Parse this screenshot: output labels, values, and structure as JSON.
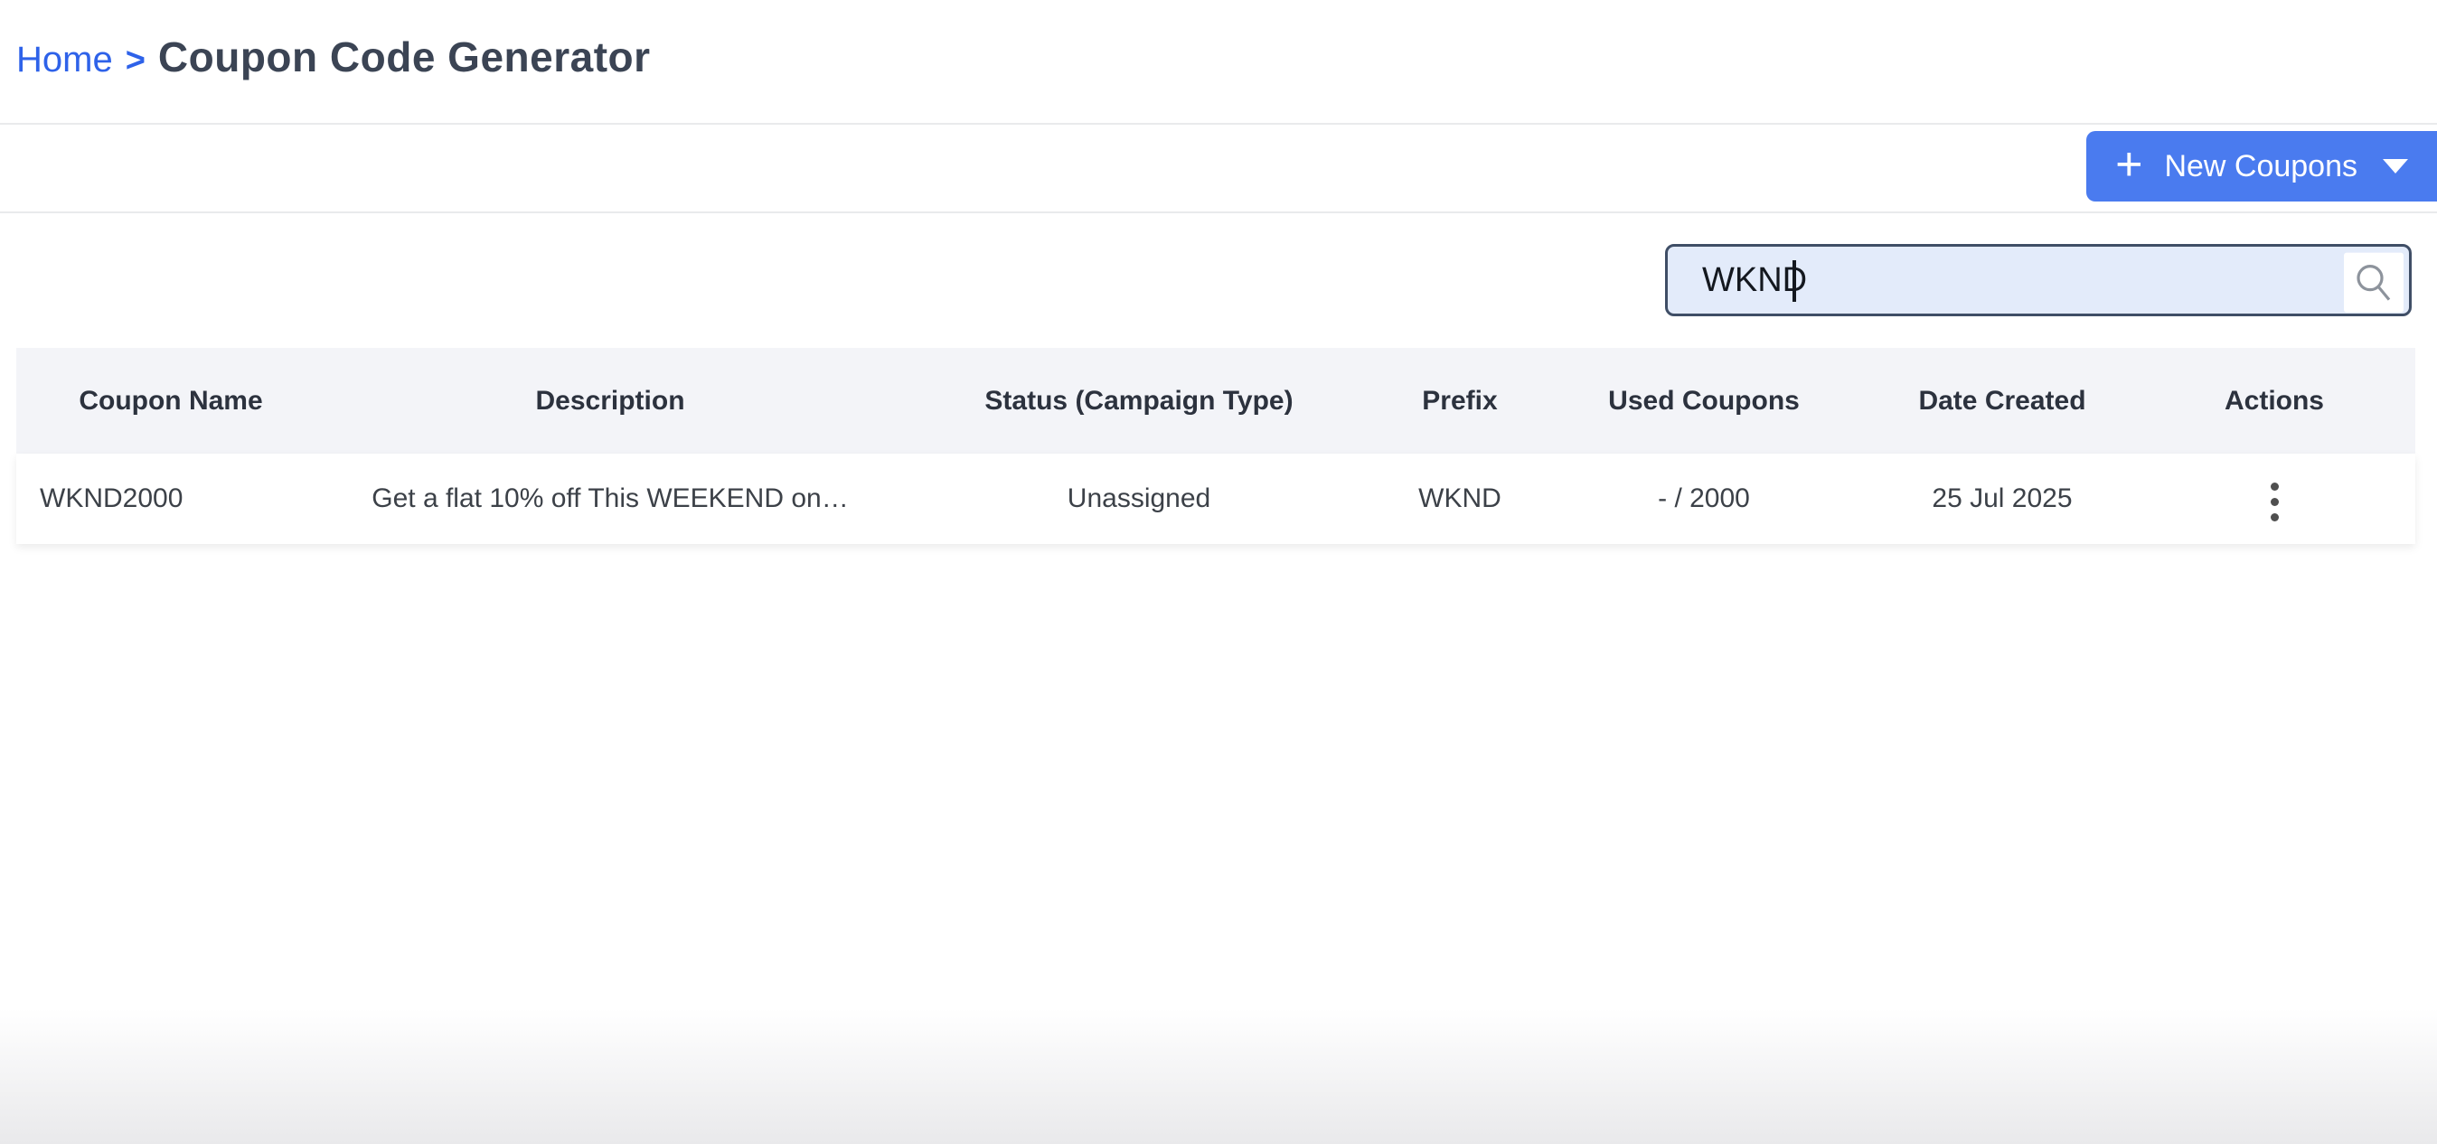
{
  "breadcrumb": {
    "home_label": "Home",
    "separator": ">",
    "page_title": "Coupon Code Generator"
  },
  "toolbar": {
    "new_coupons_label": "New Coupons",
    "plus_glyph": "+"
  },
  "search": {
    "value": "WKND",
    "placeholder": ""
  },
  "table": {
    "headers": [
      "Coupon Name",
      "Description",
      "Status (Campaign Type)",
      "Prefix",
      "Used Coupons",
      "Date Created",
      "Actions"
    ],
    "rows": [
      {
        "coupon_name": "WKND2000",
        "description": "Get a flat 10% off This WEEKEND on…",
        "status": "Unassigned",
        "prefix": "WKND",
        "used_coupons": "- / 2000",
        "date_created": "25 Jul 2025"
      }
    ]
  },
  "icons": {
    "plus": "plus-icon",
    "caret": "caret-down-icon",
    "search": "search-icon",
    "kebab": "kebab-menu-icon"
  },
  "colors": {
    "accent_blue": "#4a7bef",
    "link_blue": "#2e62e9",
    "search_fill": "#e3ebfa",
    "search_border": "#3f4e66",
    "table_header_bg": "#f3f4f8"
  }
}
